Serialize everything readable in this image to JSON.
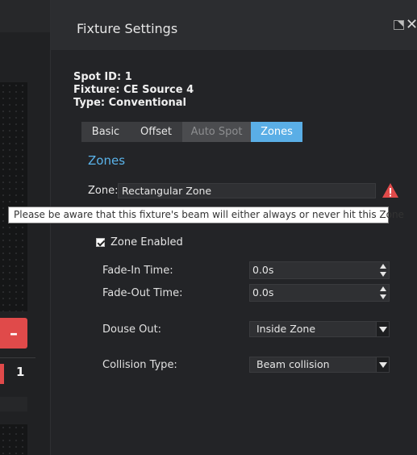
{
  "background": {
    "remove_button_label": "–",
    "row_number": "1"
  },
  "dialog": {
    "title": "Fixture Settings",
    "info": {
      "spot_id": "Spot ID: 1",
      "fixture": "Fixture: CE Source 4",
      "type": "Type: Conventional"
    },
    "tabs": [
      {
        "label": "Basic",
        "state": "normal"
      },
      {
        "label": "Offset",
        "state": "normal"
      },
      {
        "label": "Auto Spot",
        "state": "disabled"
      },
      {
        "label": "Zones",
        "state": "active"
      }
    ],
    "section_title": "Zones",
    "zone": {
      "label": "Zone:",
      "value": "Rectangular Zone",
      "warning_icon": "warning-triangle-icon"
    },
    "tooltip": "Please be aware that this fixture's beam will either always or never hit this Zone",
    "zone_enabled": {
      "label": "Zone Enabled",
      "checked": true
    },
    "fade_in": {
      "label": "Fade-In Time:",
      "value": "0.0s"
    },
    "fade_out": {
      "label": "Fade-Out Time:",
      "value": "0.0s"
    },
    "douse_out": {
      "label": "Douse Out:",
      "value": "Inside Zone"
    },
    "collision_type": {
      "label": "Collision Type:",
      "value": "Beam collision"
    }
  },
  "colors": {
    "accent": "#5aaee6",
    "danger": "#e04a4a",
    "background": "#232427"
  }
}
